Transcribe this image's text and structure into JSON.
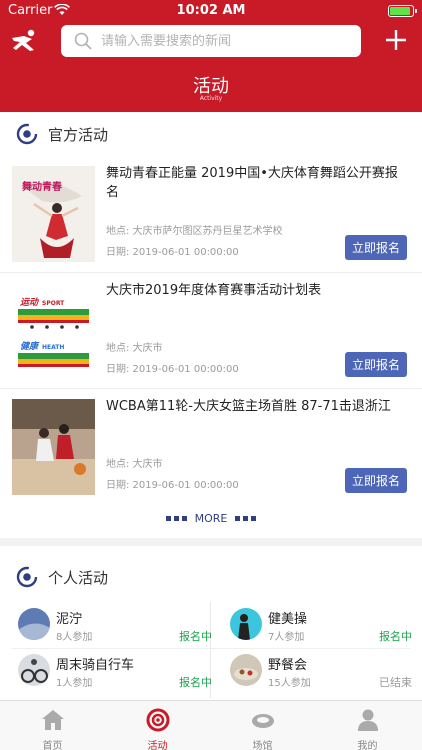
{
  "status_bar": {
    "carrier": "Carrier",
    "time": "10:02 AM"
  },
  "header": {
    "search_placeholder": "请输入需要搜索的新闻",
    "title": "活动",
    "subtitle": "Activity"
  },
  "official": {
    "section_title": "官方活动",
    "items": [
      {
        "title": "舞动青春正能量 2019中国•大庆体育舞蹈公开赛报名",
        "place": "地点: 大庆市萨尔图区苏丹巨星艺术学校",
        "date": "日期: 2019-06-01 00:00:00",
        "button": "立即报名",
        "poster_text": "舞动青春"
      },
      {
        "title": "大庆市2019年度体育赛事活动计划表",
        "place": "地点: 大庆市",
        "date": "日期: 2019-06-01 00:00:00",
        "button": "立即报名",
        "poster_labels": [
          "运动",
          "SPORT",
          "健康",
          "HEATH"
        ]
      },
      {
        "title": "WCBA第11轮-大庆女篮主场首胜 87-71击退浙江",
        "place": "地点: 大庆市",
        "date": "日期: 2019-06-01 00:00:00",
        "button": "立即报名"
      }
    ],
    "more_label": "MORE"
  },
  "personal": {
    "section_title": "个人活动",
    "items": [
      {
        "name": "泥泞",
        "count": "8人参加",
        "status": "报名中",
        "status_color": "#1aa34a"
      },
      {
        "name": "健美操",
        "count": "7人参加",
        "status": "报名中",
        "status_color": "#1aa34a"
      },
      {
        "name": "周末骑自行车",
        "count": "1人参加",
        "status": "报名中",
        "status_color": "#1aa34a"
      },
      {
        "name": "野餐会",
        "count": "15人参加",
        "status": "已结束",
        "status_color": "#999999"
      }
    ]
  },
  "tabs": [
    {
      "label": "首页",
      "icon": "home-icon",
      "active": false
    },
    {
      "label": "活动",
      "icon": "activity-target-icon",
      "active": true
    },
    {
      "label": "场馆",
      "icon": "stadium-icon",
      "active": false
    },
    {
      "label": "我的",
      "icon": "user-icon",
      "active": false
    }
  ],
  "colors": {
    "brand_red": "#c91a27",
    "button_blue": "#4d66b7",
    "signup_green": "#1aa34a"
  }
}
